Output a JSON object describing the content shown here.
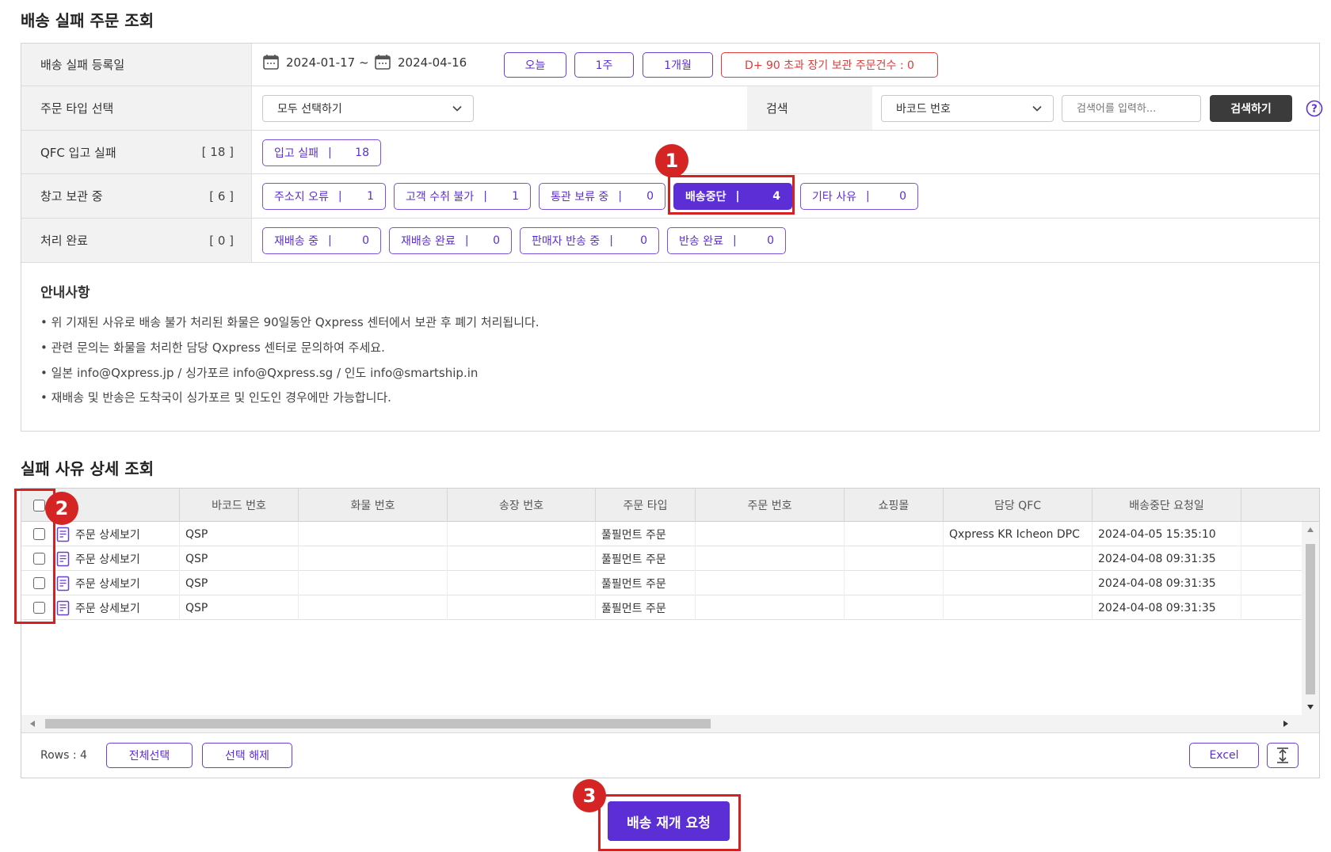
{
  "page": {
    "title": "배송 실패 주문 조회",
    "detail_title": "실패 사유 상세 조회"
  },
  "filters": {
    "date_row": {
      "label": "배송 실패 등록일",
      "start_date": "2024-01-17 ~",
      "end_date": "2024-04-16",
      "quick_buttons": [
        "오늘",
        "1주",
        "1개월"
      ],
      "long_storage_label": "D+ 90 초과 장기 보관 주문건수 : 0"
    },
    "order_type_row": {
      "label": "주문 타입 선택",
      "select_value": "모두 선택하기",
      "search_label": "검색",
      "search_field_value": "바코드 번호",
      "search_placeholder": "검색어를 입력하...",
      "search_button": "검색하기"
    },
    "qfc_row": {
      "label": "QFC 입고 실패",
      "count": "[ 18 ]",
      "pills": [
        {
          "label": "입고 실패",
          "count": "18"
        }
      ]
    },
    "warehouse_row": {
      "label": "창고 보관 중",
      "count": "[ 6 ]",
      "pills": [
        {
          "label": "주소지 오류",
          "count": "1"
        },
        {
          "label": "고객 수취 불가",
          "count": "1"
        },
        {
          "label": "통관 보류 중",
          "count": "0"
        },
        {
          "label": "배송중단",
          "count": "4",
          "active": true
        },
        {
          "label": "기타 사유",
          "count": "0"
        }
      ]
    },
    "done_row": {
      "label": "처리 완료",
      "count": "[ 0 ]",
      "pills": [
        {
          "label": "재배송 중",
          "count": "0"
        },
        {
          "label": "재배송 완료",
          "count": "0"
        },
        {
          "label": "판매자 반송 중",
          "count": "0"
        },
        {
          "label": "반송 완료",
          "count": "0"
        }
      ]
    },
    "separator": "|"
  },
  "notice": {
    "title": "안내사항",
    "lines": [
      "• 위 기재된 사유로 배송 불가 처리된 화물은 90일동안 Qxpress 센터에서 보관 후 폐기 처리됩니다.",
      "• 관련 문의는 화물을 처리한 담당 Qxpress 센터로 문의하여 주세요.",
      "• 일본 info@Qxpress.jp / 싱가포르 info@Qxpress.sg / 인도 info@smartship.in",
      "• 재배송 및 반송은 도착국이 싱가포르 및 인도인 경우에만 가능합니다."
    ]
  },
  "table": {
    "columns": [
      "바코드 번호",
      "화물 번호",
      "송장 번호",
      "주문 타입",
      "주문 번호",
      "쇼핑몰",
      "담당 QFC",
      "배송중단 요청일"
    ],
    "rows": [
      {
        "detail": "주문 상세보기",
        "barcode": "QSP",
        "cargo": "",
        "invoice": "",
        "order_type": "풀필먼트 주문",
        "order_no": "",
        "mall": "",
        "qfc": "Qxpress KR Icheon DPC",
        "requested": "2024-04-05 15:35:10"
      },
      {
        "detail": "주문 상세보기",
        "barcode": "QSP",
        "cargo": "",
        "invoice": "",
        "order_type": "풀필먼트 주문",
        "order_no": "",
        "mall": "",
        "qfc": "",
        "requested": "2024-04-08 09:31:35"
      },
      {
        "detail": "주문 상세보기",
        "barcode": "QSP",
        "cargo": "",
        "invoice": "",
        "order_type": "풀필먼트 주문",
        "order_no": "",
        "mall": "",
        "qfc": "",
        "requested": "2024-04-08 09:31:35"
      },
      {
        "detail": "주문 상세보기",
        "barcode": "QSP",
        "cargo": "",
        "invoice": "",
        "order_type": "풀필먼트 주문",
        "order_no": "",
        "mall": "",
        "qfc": "",
        "requested": "2024-04-08 09:31:35"
      }
    ],
    "rows_label": "Rows : 4",
    "select_all": "전체선택",
    "deselect": "선택 해제",
    "excel": "Excel"
  },
  "actions": {
    "resume_delivery": "배송 재개 요청"
  },
  "annotations": {
    "badge1": "1",
    "badge2": "2",
    "badge3": "3"
  },
  "colors": {
    "accent": "#5c2fd6",
    "highlight": "#d32222",
    "warning": "#e03a3a"
  },
  "icons": [
    "calendar-icon",
    "chevron-down-icon",
    "help-icon",
    "document-icon",
    "expand-icon"
  ]
}
